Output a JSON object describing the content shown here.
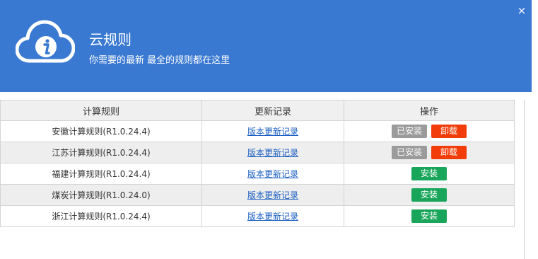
{
  "header": {
    "title": "云规则",
    "subtitle": "你需要的最新 最全的规则都在这里",
    "close_glyph": "×",
    "icon": "cloud-info-icon",
    "background_color": "#3a79d1"
  },
  "table": {
    "columns": [
      "计算规则",
      "更新记录",
      "操作"
    ],
    "rows": [
      {
        "rule": "安徽计算规则(R1.0.24.4)",
        "changelog": "版本更新记录",
        "installed_label": "已安装",
        "uninstall_label": "卸载"
      },
      {
        "rule": "江苏计算规则(R1.0.24.4)",
        "changelog": "版本更新记录",
        "installed_label": "已安装",
        "uninstall_label": "卸载"
      },
      {
        "rule": "福建计算规则(R1.0.24.4)",
        "changelog": "版本更新记录",
        "install_label": "安装"
      },
      {
        "rule": "煤炭计算规则(R1.0.24.0)",
        "changelog": "版本更新记录",
        "install_label": "安装"
      },
      {
        "rule": "浙江计算规则(R1.0.24.4)",
        "changelog": "版本更新记录",
        "install_label": "安装"
      }
    ]
  },
  "colors": {
    "installed": "#9b9b9b",
    "uninstall": "#f23c0a",
    "install": "#1aa65a",
    "link": "#1a5fc2"
  }
}
